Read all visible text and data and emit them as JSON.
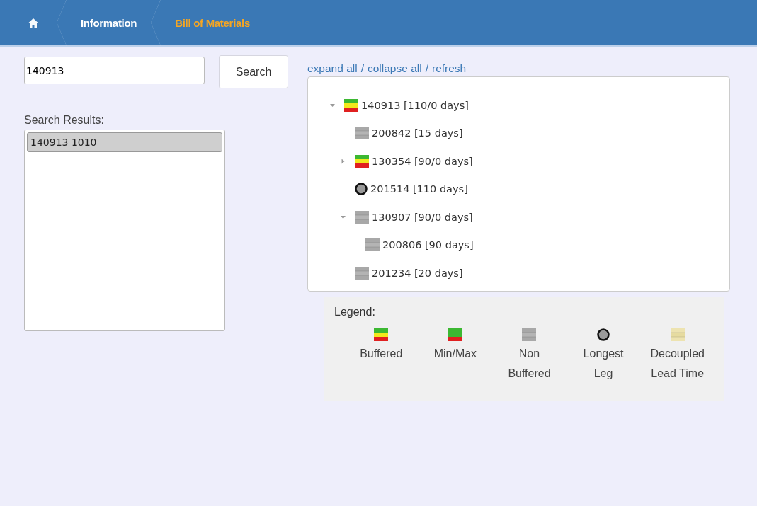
{
  "breadcrumb": [
    {
      "kind": "home",
      "selected": false
    },
    {
      "kind": "text",
      "label": "Information",
      "selected": false
    },
    {
      "kind": "text",
      "label": "Bill of Materials",
      "selected": true
    }
  ],
  "search": {
    "value": "140913",
    "button": "Search"
  },
  "results": {
    "label": "Search Results:",
    "items": [
      {
        "label": "140913 1010",
        "selected": true
      }
    ]
  },
  "toolbar": [
    {
      "label": "expand all",
      "separator": "/"
    },
    {
      "label": "collapse all",
      "separator": "/"
    },
    {
      "label": "refresh"
    }
  ],
  "tree": [
    {
      "label": "140913 [110/0 days]",
      "kind": "buffered",
      "expanded": true,
      "children": [
        {
          "label": "200842 [15 days]",
          "kind": "nonbuffered"
        },
        {
          "label": "130354 [90/0 days]",
          "kind": "buffered",
          "expanded": false
        },
        {
          "label": "201514 [110 days]",
          "kind": "longest"
        },
        {
          "label": "130907 [90/0 days]",
          "kind": "nonbuffered",
          "expanded": true,
          "children": [
            {
              "label": "200806 [90 days]",
              "kind": "nonbuffered"
            }
          ]
        },
        {
          "label": "201234 [20 days]",
          "kind": "nonbuffered"
        }
      ]
    }
  ],
  "legend": {
    "title": "Legend:",
    "items": [
      {
        "kind": "buffered",
        "label": [
          "Buffered"
        ]
      },
      {
        "kind": "minmax",
        "label": [
          "Min/Max"
        ]
      },
      {
        "kind": "nonbuffered",
        "label": [
          "Non",
          "Buffered"
        ]
      },
      {
        "kind": "longest",
        "label": [
          "Longest",
          "Leg"
        ]
      },
      {
        "kind": "decoupled",
        "label": [
          "Decoupled",
          "Lead Time"
        ]
      }
    ]
  }
}
